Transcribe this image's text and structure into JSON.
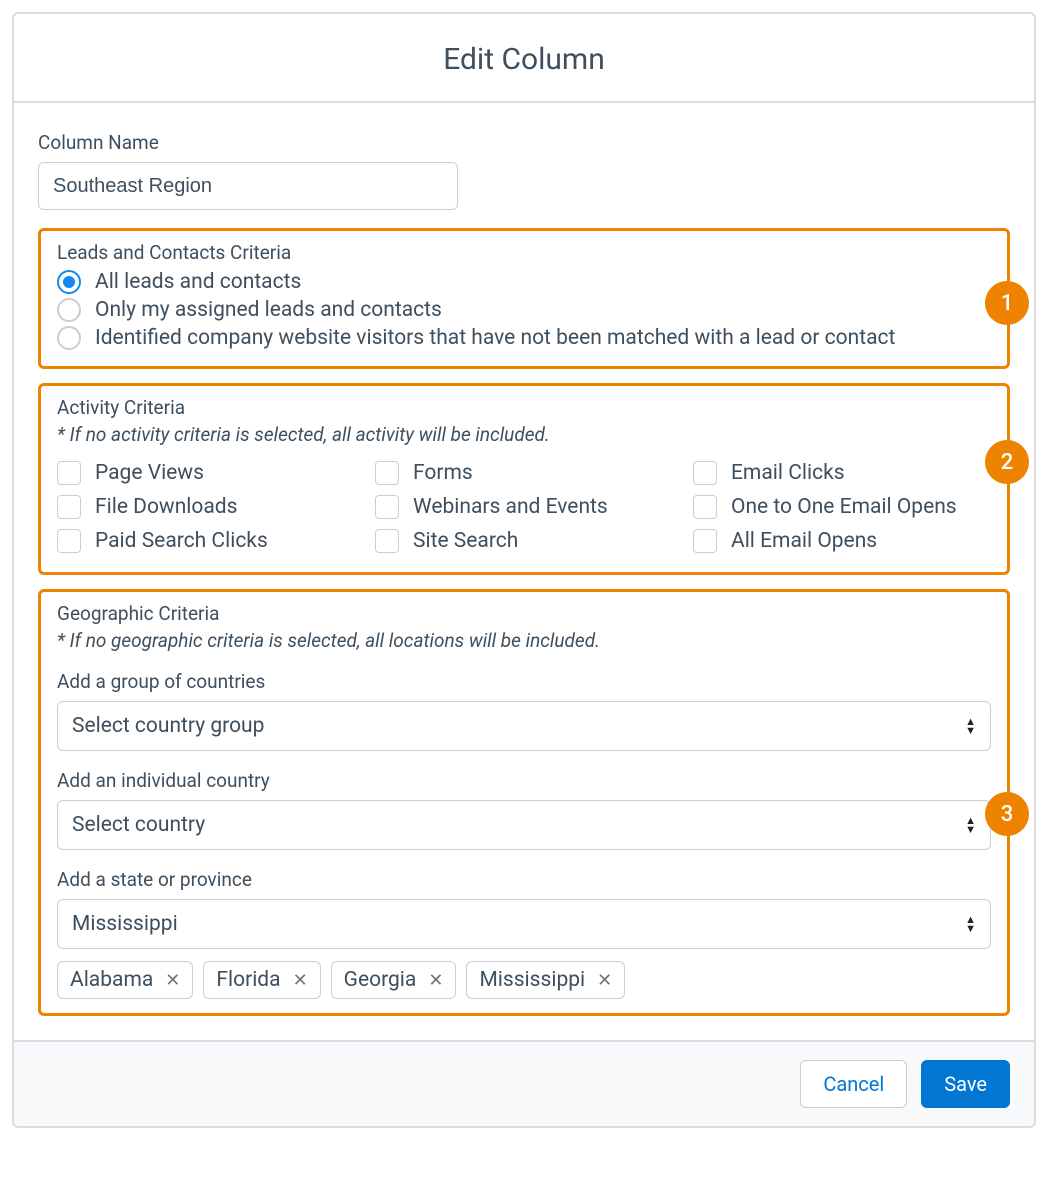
{
  "dialog": {
    "title": "Edit Column",
    "columnName": {
      "label": "Column Name",
      "value": "Southeast Region"
    },
    "leads": {
      "title": "Leads and Contacts Criteria",
      "options": [
        {
          "label": "All leads and contacts",
          "checked": true
        },
        {
          "label": "Only my assigned leads and contacts",
          "checked": false
        },
        {
          "label": "Identified company website visitors that have not been matched with a lead or contact",
          "checked": false
        }
      ],
      "callout": "1"
    },
    "activity": {
      "title": "Activity Criteria",
      "note": "* If no activity criteria is selected, all activity will be included.",
      "items": [
        "Page Views",
        "Forms",
        "Email Clicks",
        "File Downloads",
        "Webinars and Events",
        "One to One Email Opens",
        "Paid Search Clicks",
        "Site Search",
        "All Email Opens"
      ],
      "callout": "2"
    },
    "geo": {
      "title": "Geographic Criteria",
      "note": "* If no geographic criteria is selected, all locations will be included.",
      "countryGroup": {
        "label": "Add a group of countries",
        "value": "Select country group"
      },
      "country": {
        "label": "Add an individual country",
        "value": "Select country"
      },
      "state": {
        "label": "Add a state or province",
        "value": "Mississippi"
      },
      "chips": [
        "Alabama",
        "Florida",
        "Georgia",
        "Mississippi"
      ],
      "callout": "3"
    },
    "footer": {
      "cancel": "Cancel",
      "save": "Save"
    }
  }
}
